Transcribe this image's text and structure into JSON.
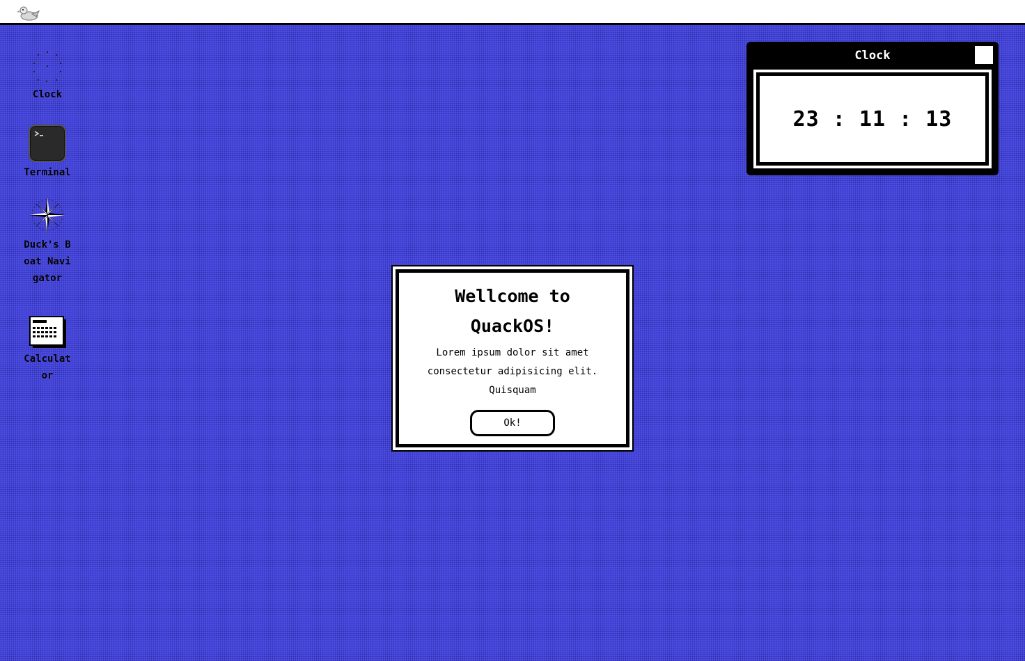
{
  "menubar": {
    "logo_icon": "duck-logo-icon"
  },
  "desktop_icons": [
    {
      "label": "Clock",
      "icon": "clock-icon"
    },
    {
      "label": "Terminal",
      "icon": "terminal-icon"
    },
    {
      "label": "Duck's Boat Navigator",
      "icon": "compass-icon"
    },
    {
      "label": "Calculator",
      "icon": "calculator-icon"
    }
  ],
  "clock_window": {
    "title": "Clock",
    "time": "23 : 11 : 13"
  },
  "dialog": {
    "title": "Wellcome to QuackOS!",
    "body": "Lorem ipsum dolor sit amet consectetur adipisicing elit. Quisquam",
    "ok_label": "Ok!"
  },
  "colors": {
    "desktop": "#4b4be0",
    "window": "#000000",
    "panel": "#ffffff"
  }
}
